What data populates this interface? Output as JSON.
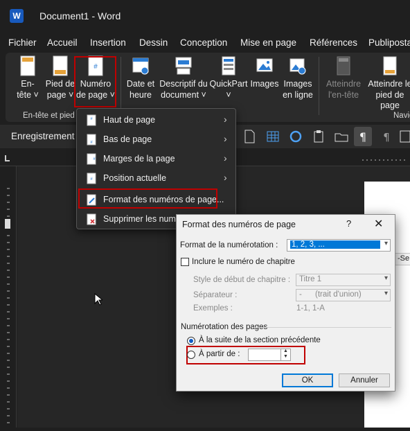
{
  "title_bar": {
    "logo": "W",
    "document_title": "Document1 - Word"
  },
  "menu": {
    "tabs": [
      "Fichier",
      "Accueil",
      "Insertion",
      "Dessin",
      "Conception",
      "Mise en page",
      "Références",
      "Publiposta"
    ]
  },
  "ribbon": {
    "entete": [
      "En-",
      "tête ˅"
    ],
    "pied": [
      "Pied de",
      "page ˅"
    ],
    "numero": [
      "Numéro",
      "de page ˅"
    ],
    "date": [
      "Date et",
      "heure"
    ],
    "descriptif": [
      "Descriptif du",
      "document ˅"
    ],
    "quickpart": [
      "QuickPart",
      "˅"
    ],
    "images": [
      "Images",
      ""
    ],
    "images_en_ligne": [
      "Images",
      "en ligne"
    ],
    "atteindre_entete": [
      "Atteindre",
      "l'en-tête"
    ],
    "atteindre_pied": [
      "Atteindre le",
      "pied de page"
    ],
    "group_entete_label": "En-tête et pied",
    "group_navig_label": "Navig"
  },
  "toolbar2": {
    "autosave": "Enregistrement a"
  },
  "page_snippet": "-Se",
  "dropdown": {
    "items": [
      {
        "label": "Haut de page",
        "has_submenu": true
      },
      {
        "label": "Bas de page",
        "has_submenu": true
      },
      {
        "label": "Marges de la page",
        "has_submenu": true
      },
      {
        "label": "Position actuelle",
        "has_submenu": true
      },
      {
        "label": "Format des numéros de page...",
        "has_submenu": false
      },
      {
        "label": "Supprimer les numé",
        "has_submenu": false
      }
    ]
  },
  "dialog": {
    "title": "Format des numéros de page",
    "help": "?",
    "close": "✕",
    "format_label": "Format de la numérotation :",
    "format_value": "1, 2, 3, ...",
    "include_chapter": "Inclure le numéro de chapitre",
    "chapter_style_label": "Style de début de chapitre :",
    "chapter_style_value": "Titre 1",
    "separator_label": "Séparateur :",
    "separator_value": "-      (trait d'union)",
    "examples_label": "Exemples :",
    "examples_value": "1-1, 1-A",
    "numbering_group": "Numérotation des pages",
    "continue_option": "À la suite de la section précédente",
    "start_at_option": "À partir de :",
    "start_at_value": "",
    "ok": "OK",
    "cancel": "Annuler"
  },
  "colors": {
    "accent_red": "#c00000",
    "word_blue": "#185abd",
    "selection_blue": "#0078d7"
  }
}
